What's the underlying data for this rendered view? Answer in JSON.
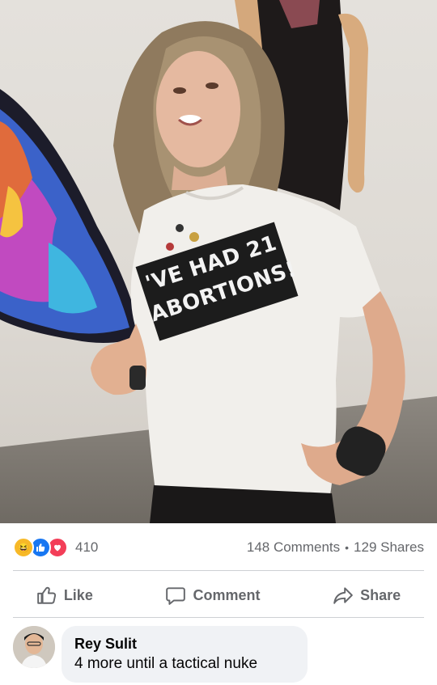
{
  "post": {
    "photo": {
      "shirt_line1": "'VE HAD 21",
      "shirt_line2": "ABORTIONS!"
    },
    "reactions": {
      "icons": [
        "haha-icon",
        "like-icon",
        "love-icon"
      ],
      "count": "410"
    },
    "comments_count": "148 Comments",
    "separator": "•",
    "shares_count": "129 Shares",
    "actions": {
      "like_label": "Like",
      "comment_label": "Comment",
      "share_label": "Share"
    }
  },
  "comment": {
    "author": "Rey Sulit",
    "text": "4 more until a tactical nuke"
  },
  "colors": {
    "accent": "#1877f2",
    "love": "#f33e58",
    "haha": "#f7b928",
    "muted_text": "#65676b",
    "bubble_bg": "#f0f2f5"
  }
}
